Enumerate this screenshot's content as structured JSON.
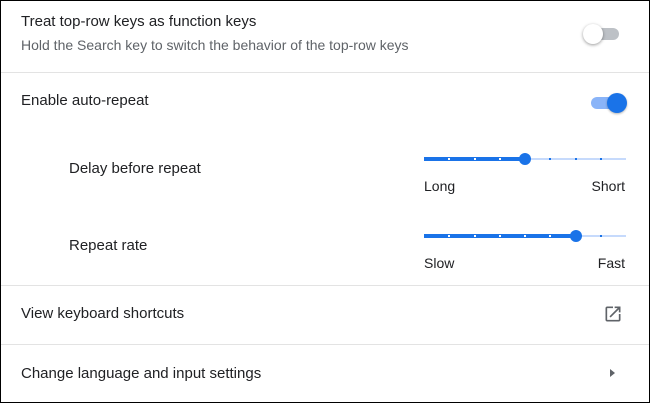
{
  "function_keys": {
    "title": "Treat top-row keys as function keys",
    "description": "Hold the Search key to switch the behavior of the top-row keys",
    "enabled": false
  },
  "auto_repeat": {
    "title": "Enable auto-repeat",
    "enabled": true
  },
  "delay_before_repeat": {
    "label": "Delay before repeat",
    "min_label": "Long",
    "max_label": "Short",
    "value": 0.5,
    "steps": 8
  },
  "repeat_rate": {
    "label": "Repeat rate",
    "min_label": "Slow",
    "max_label": "Fast",
    "value": 0.75,
    "steps": 8
  },
  "keyboard_shortcuts": {
    "label": "View keyboard shortcuts",
    "icon": "open-in-new-icon"
  },
  "language_input": {
    "label": "Change language and input settings",
    "icon": "arrow-right-icon"
  },
  "colors": {
    "accent": "#1a73e8",
    "accent_light": "#8ab4f8",
    "text_primary": "#202124",
    "text_secondary": "#5f6368"
  }
}
